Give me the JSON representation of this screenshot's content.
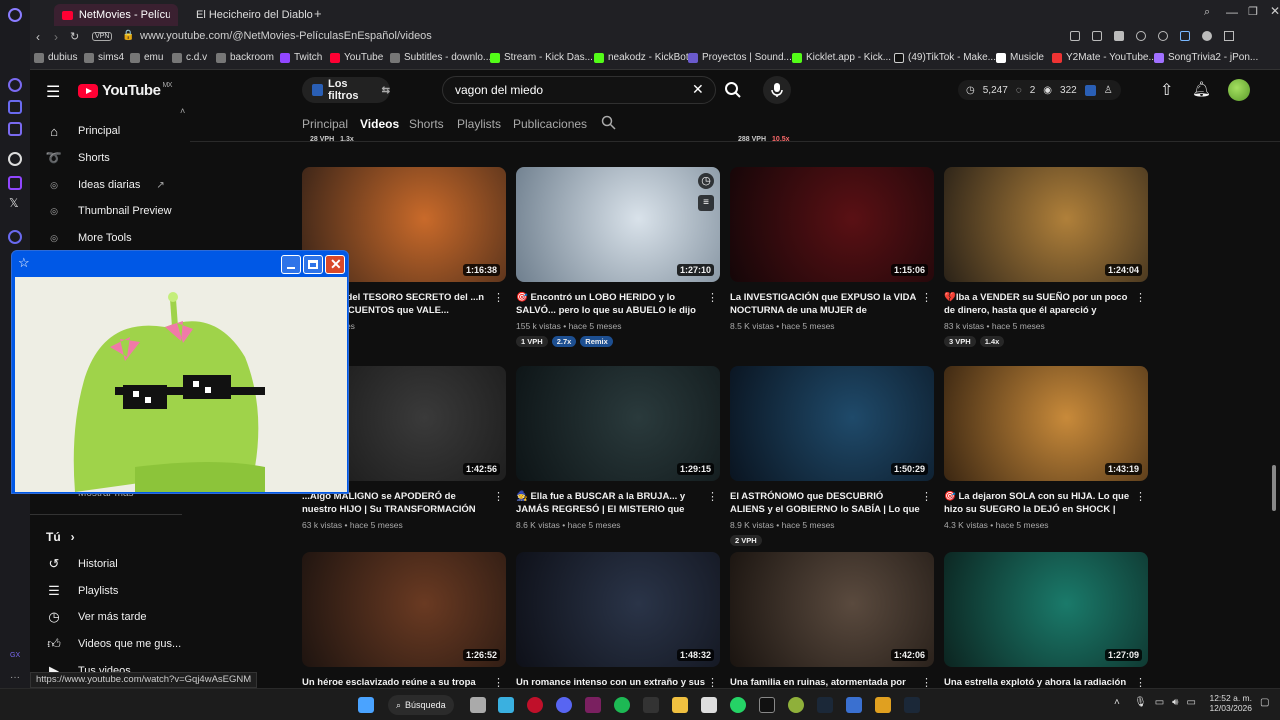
{
  "browser": {
    "tabs": [
      {
        "label": "NetMovies - Películas En E",
        "active": true
      },
      {
        "label": "El Hecicheiro del Diablo",
        "active": false
      }
    ],
    "vpn_label": "VPN",
    "url": "www.youtube.com/@NetMovies-PelículasEnEspañol/videos",
    "bookmarks": [
      "dubius",
      "sims4",
      "emu",
      "c.d.v",
      "backroom",
      "Twitch",
      "YouTube",
      "Subtitles - downlo...",
      "Stream - Kick Das...",
      "neakodz - KickBot",
      "Proyectos | Sound...",
      "Kicklet.app - Kick...",
      "(49)TikTok - Make...",
      "Musicle",
      "Y2Mate - YouTube...",
      "SongTrivia2 - jPon..."
    ]
  },
  "youtube": {
    "logo_text": "YouTube",
    "logo_region": "MX",
    "filters_label": "Los filtros",
    "search_value": "vagon del miedo",
    "stats": {
      "time": "5,247",
      "clips": "2",
      "views": "322"
    }
  },
  "sidebar": {
    "items": [
      {
        "label": "Principal",
        "icon": "home-icon"
      },
      {
        "label": "Shorts",
        "icon": "shorts-icon"
      },
      {
        "label": "Ideas diarias",
        "icon": "extension-icon"
      },
      {
        "label": "Thumbnail Preview",
        "icon": "extension-icon"
      },
      {
        "label": "More Tools",
        "icon": "extension-icon"
      }
    ],
    "partial_item": "Mostrar más",
    "you_section": "Tú",
    "you_items": [
      {
        "label": "Historial",
        "icon": "history-icon"
      },
      {
        "label": "Playlists",
        "icon": "playlist-icon"
      },
      {
        "label": "Ver más tarde",
        "icon": "clock-icon"
      },
      {
        "label": "Videos que me gus...",
        "icon": "like-icon"
      },
      {
        "label": "Tus videos",
        "icon": "video-icon"
      }
    ]
  },
  "channel_tabs": [
    "Principal",
    "Videos",
    "Shorts",
    "Playlists",
    "Publicaciones"
  ],
  "top_partial": {
    "left": "28 VPH",
    "left2": "1.3x",
    "right": "288 VPH",
    "right2": "10.5x"
  },
  "videos": [
    {
      "title": "...QUEDA del TESORO SECRETO del ...n LIBRO de CUENTOS que VALE...",
      "meta": "hace 5 meses",
      "dur": "1:16:38",
      "pills": [],
      "c1": "#c96a2a",
      "c2": "#3a2418"
    },
    {
      "title": "🎯 Encontró un LOBO HERIDO y lo SALVÓ... pero lo que su ABUELO le dijo le ROMPIÓ el...",
      "meta": "155 k vistas • hace 5 meses",
      "dur": "1:27:10",
      "pills": [
        "1 VPH",
        "2.7x",
        "Remix"
      ],
      "c1": "#d9e2ea",
      "c2": "#6f7f8e"
    },
    {
      "title": "La INVESTIGACIÓN que EXPUSO la VIDA NOCTURNA de una MUJER de NEGOCIOS...",
      "meta": "8.5 K vistas • hace 5 meses",
      "dur": "1:15:06",
      "pills": [],
      "c1": "#5a1014",
      "c2": "#140608"
    },
    {
      "title": "💔Iba a VENDER su SUEÑO por un poco de dinero, hasta que él apareció y TODO...",
      "meta": "83 k vistas • hace 5 meses",
      "dur": "1:24:04",
      "pills": [
        "3 VPH",
        "1.4x"
      ],
      "c1": "#b0803a",
      "c2": "#2a2218"
    },
    {
      "title": "...Algo MALIGNO se APODERÓ de nuestro HIJO | Su TRANSFORMACIÓN nos HELÓ la...",
      "meta": "63 k vistas • hace 5 meses",
      "dur": "1:42:56",
      "pills": [],
      "c1": "#3a3a3a",
      "c2": "#151515"
    },
    {
      "title": "🧙 Ella fue a BUSCAR a la BRUJA... y JAMÁS REGRESÓ | El MISTERIO que AÚN...",
      "meta": "8.6 K vistas • hace 5 meses",
      "dur": "1:29:15",
      "pills": [],
      "c1": "#2a3a3c",
      "c2": "#0d1416"
    },
    {
      "title": "El ASTRÓNOMO que DESCUBRIÓ ALIENS y el GOBIERNO lo SABÍA | Lo que HICIERON...",
      "meta": "8.9 K vistas • hace 5 meses",
      "dur": "1:50:29",
      "pills": [
        "2 VPH"
      ],
      "c1": "#1f4a6a",
      "c2": "#0a1420"
    },
    {
      "title": "🎯 La dejaron SOLA con su HIJA. Lo que hizo su SUEGRO la DEJÓ en SHOCK | Una...",
      "meta": "4.3 K vistas • hace 5 meses",
      "dur": "1:43:19",
      "pills": [],
      "c1": "#c88a3a",
      "c2": "#3a2612"
    },
    {
      "title": "Un héroe esclavizado reúne a su tropa para",
      "meta": "",
      "dur": "1:26:52",
      "pills": [],
      "c1": "#6a3a22",
      "c2": "#1e1410"
    },
    {
      "title": "Un romance intenso con un extraño y sus",
      "meta": "",
      "dur": "1:48:32",
      "pills": [],
      "c1": "#2a3448",
      "c2": "#0e1018"
    },
    {
      "title": "Una familia en ruinas, atormentada por",
      "meta": "",
      "dur": "1:42:06",
      "pills": [],
      "c1": "#5a4a3e",
      "c2": "#1a1410"
    },
    {
      "title": "Una estrella explotó y ahora la radiación",
      "meta": "",
      "dur": "1:27:09",
      "pills": [],
      "c1": "#1a7a6a",
      "c2": "#0c2420"
    }
  ],
  "status_url": "https://www.youtube.com/watch?v=Gqj4wAsEGNM",
  "taskbar": {
    "search_label": "Búsqueda",
    "time": "12:52 a. m.",
    "date": "12/03/2026"
  }
}
